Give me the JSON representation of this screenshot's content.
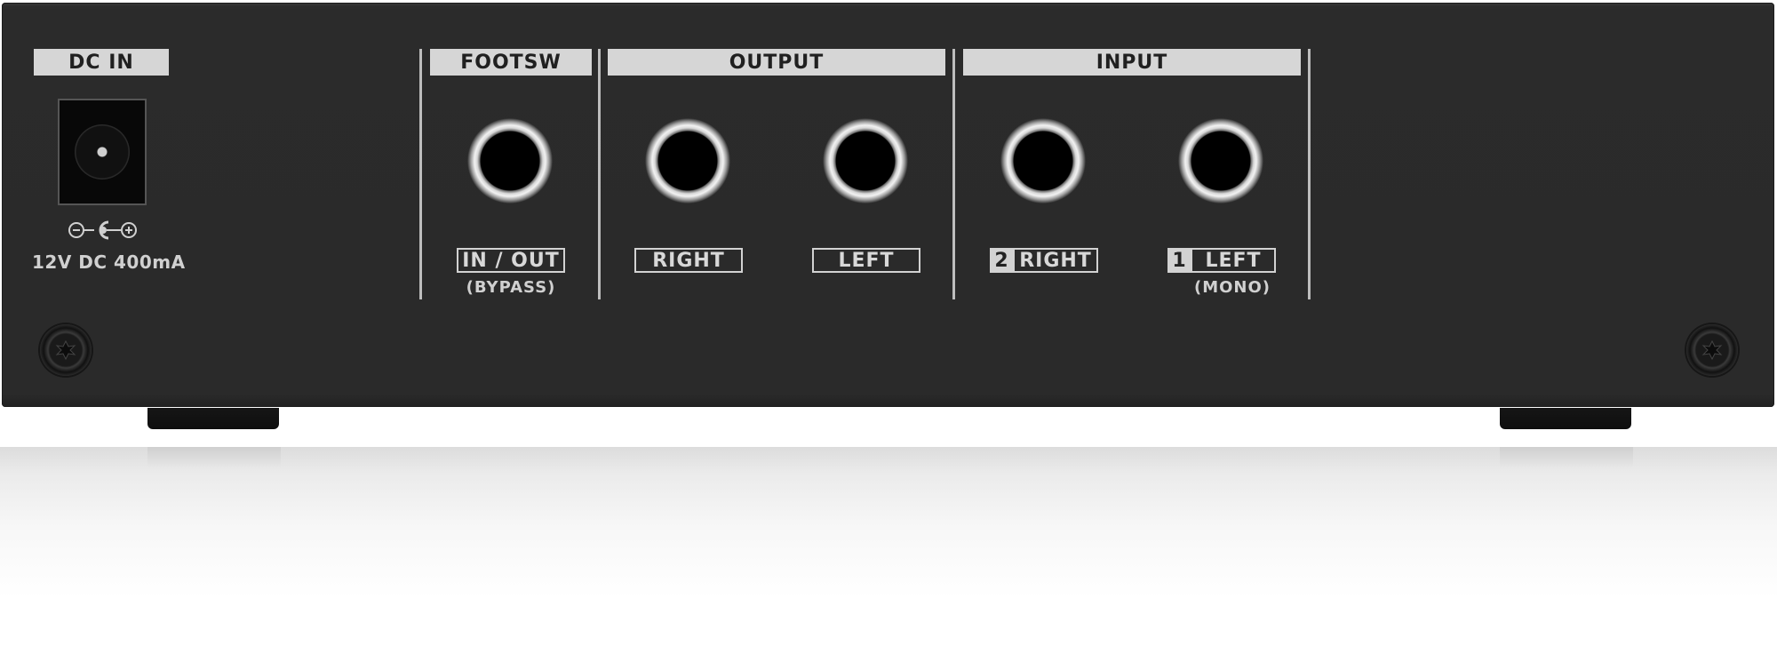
{
  "panel": {
    "dc_in": {
      "title": "DC IN",
      "spec": "12V DC 400mA",
      "polarity_icon": "dc-polarity-icon"
    },
    "footsw": {
      "title": "FOOTSW",
      "jack_label": "IN / OUT",
      "jack_sublabel": "(BYPASS)"
    },
    "output": {
      "title": "OUTPUT",
      "jacks": [
        {
          "label": "RIGHT"
        },
        {
          "label": "LEFT"
        }
      ]
    },
    "input": {
      "title": "INPUT",
      "jacks": [
        {
          "number": "2",
          "label": "RIGHT",
          "sublabel": ""
        },
        {
          "number": "1",
          "label": "LEFT",
          "sublabel": "(MONO)"
        }
      ]
    }
  },
  "colors": {
    "chassis": "#2b2b2b",
    "label_band": "#d6d6d6",
    "screen_print": "#d2d2d2"
  }
}
